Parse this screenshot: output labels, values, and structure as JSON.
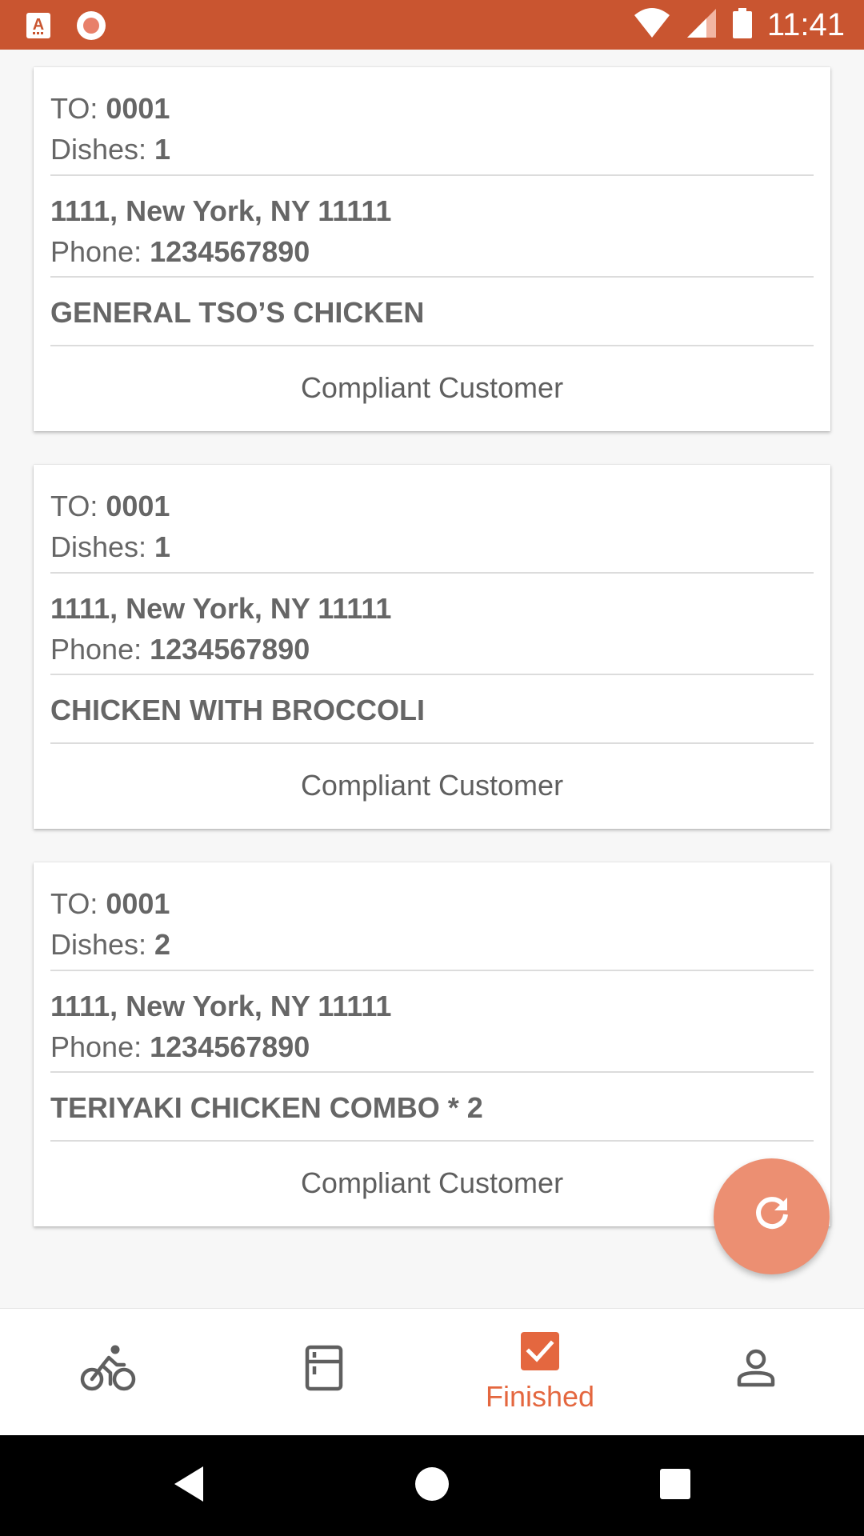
{
  "status_bar": {
    "time": "11:41",
    "icons": [
      "app-notification-icon",
      "record-icon",
      "wifi-icon",
      "signal-icon",
      "battery-icon"
    ]
  },
  "orders": [
    {
      "to_label": "TO: ",
      "to_value": "0001",
      "dishes_label": "Dishes: ",
      "dishes_value": "1",
      "address": "1111, New York, NY 11111",
      "phone_label": "Phone: ",
      "phone_value": "1234567890",
      "dish": "GENERAL TSO’S CHICKEN",
      "action_label": "Compliant Customer"
    },
    {
      "to_label": "TO: ",
      "to_value": "0001",
      "dishes_label": "Dishes: ",
      "dishes_value": "1",
      "address": "1111, New York, NY 11111",
      "phone_label": "Phone: ",
      "phone_value": "1234567890",
      "dish": "CHICKEN WITH BROCCOLI",
      "action_label": "Compliant Customer"
    },
    {
      "to_label": "TO: ",
      "to_value": "0001",
      "dishes_label": "Dishes: ",
      "dishes_value": "2",
      "address": "1111, New York, NY 11111",
      "phone_label": "Phone: ",
      "phone_value": "1234567890",
      "dish": "TERIYAKI CHICKEN COMBO * 2",
      "action_label": "Compliant Customer"
    }
  ],
  "fab": {
    "icon": "refresh-icon"
  },
  "bottom_nav": {
    "items": [
      {
        "icon": "bicycle-icon",
        "label": ""
      },
      {
        "icon": "fridge-icon",
        "label": ""
      },
      {
        "icon": "checkbox-icon",
        "label": "Finished",
        "active": true
      },
      {
        "icon": "person-icon",
        "label": ""
      }
    ]
  },
  "colors": {
    "status_bar": "#c95530",
    "accent": "#e4673f",
    "fab": "#ec8f72",
    "background": "#f7f7f7"
  }
}
